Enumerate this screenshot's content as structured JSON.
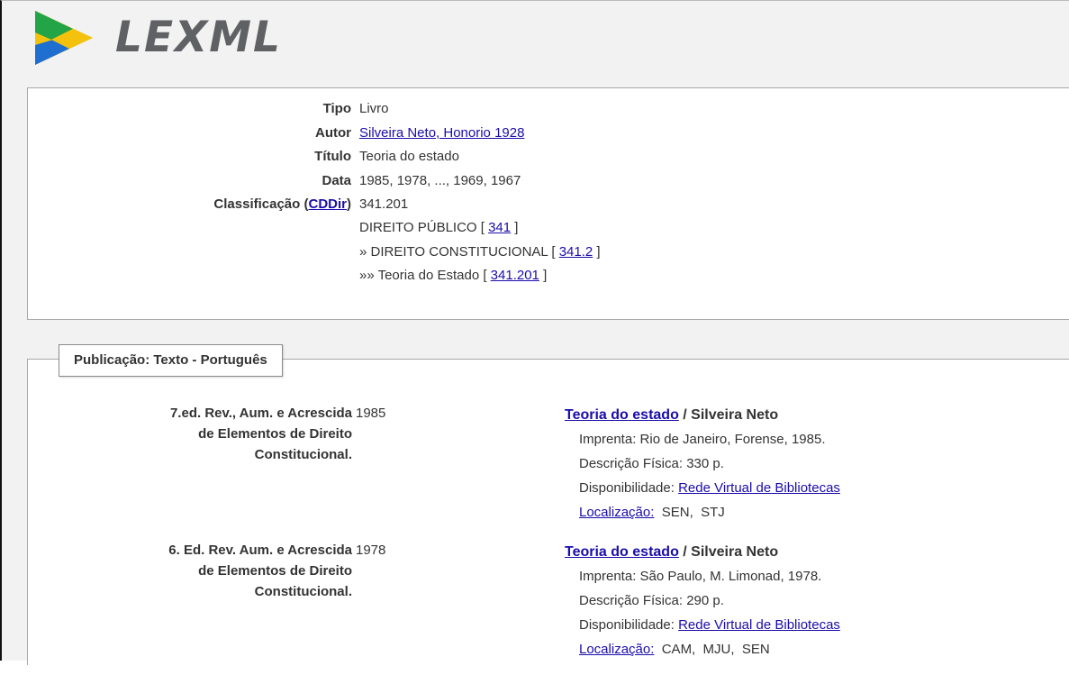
{
  "logo": {
    "text": "LEXML"
  },
  "details": {
    "tipo": {
      "label": "Tipo",
      "value": "Livro"
    },
    "autor": {
      "label": "Autor",
      "value": "Silveira Neto, Honorio 1928"
    },
    "titulo": {
      "label": "Título",
      "value": "Teoria do estado"
    },
    "data": {
      "label": "Data",
      "value": "1985, 1978, ..., 1969, 1967"
    },
    "classificacao": {
      "label_prefix": "Classificação (",
      "label_link": "CDDir",
      "label_suffix": ")",
      "value": "341.201",
      "hierarchy": [
        {
          "prefix": "",
          "text": "DIREITO PÚBLICO [ ",
          "code": "341",
          "suffix": " ]"
        },
        {
          "prefix": "» ",
          "text": "DIREITO CONSTITUCIONAL [ ",
          "code": "341.2",
          "suffix": " ]"
        },
        {
          "prefix": "»» ",
          "text": "Teoria do Estado [ ",
          "code": "341.201",
          "suffix": " ]"
        }
      ]
    }
  },
  "publication": {
    "tab_label": "Publicação: Texto - Português",
    "editions": [
      {
        "edition_lines": [
          "7.ed. Rev., Aum. e Acrescida",
          "de Elementos de Direito",
          "Constitucional."
        ],
        "year": "1985",
        "title_link": "Teoria do estado",
        "author": " / Silveira Neto",
        "imprenta": "Imprenta: Rio de Janeiro, Forense, 1985.",
        "descricao": "Descrição Física: 330 p.",
        "disponibilidade_label": "Disponibilidade: ",
        "disponibilidade_link": "Rede Virtual de Bibliotecas",
        "localizacao_label": "Localização:",
        "localizacao_value": "  SEN,  STJ"
      },
      {
        "edition_lines": [
          "6. Ed. Rev. Aum. e Acrescida",
          "de Elementos de Direito",
          "Constitucional."
        ],
        "year": "1978",
        "title_link": "Teoria do estado",
        "author": " / Silveira Neto",
        "imprenta": "Imprenta: São Paulo, M. Limonad, 1978.",
        "descricao": "Descrição Física: 290 p.",
        "disponibilidade_label": "Disponibilidade: ",
        "disponibilidade_link": "Rede Virtual de Bibliotecas",
        "localizacao_label": "Localização:",
        "localizacao_value": "  CAM,  MJU,  SEN"
      }
    ]
  },
  "colors": {
    "link": "#1a0dab",
    "logo_gray": "#5f6164",
    "logo_yellow": "#f4c20d",
    "logo_green": "#22a447",
    "logo_blue": "#1f6fd1"
  }
}
